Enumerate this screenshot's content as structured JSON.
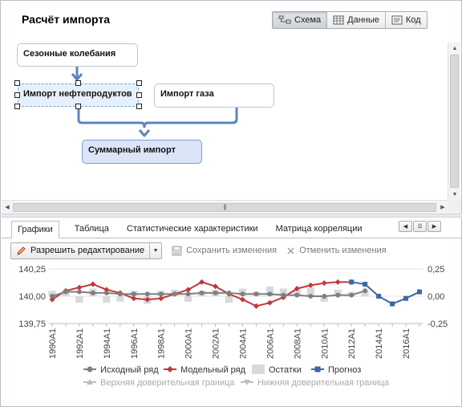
{
  "window": {
    "title": "Расчёт импорта"
  },
  "view_switch": {
    "buttons": [
      {
        "label": "Схема",
        "icon": "scheme-icon",
        "active": true
      },
      {
        "label": "Данные",
        "icon": "table-icon",
        "active": false
      },
      {
        "label": "Код",
        "icon": "code-icon",
        "active": false
      }
    ]
  },
  "diagram": {
    "nodes": {
      "seasonal": "Сезонные колебания",
      "oil_import": "Импорт нефтепродуктов",
      "gas_import": "Импорт газа",
      "total_import": "Суммарный импорт"
    },
    "edges": [
      {
        "from": "Сезонные колебания",
        "to": "Импорт нефтепродуктов"
      },
      {
        "from": "Импорт нефтепродуктов",
        "to": "Суммарный импорт"
      },
      {
        "from": "Импорт газа",
        "to": "Суммарный импорт"
      }
    ],
    "selected_node": "Импорт нефтепродуктов"
  },
  "tabs": {
    "items": [
      "Графики",
      "Таблица",
      "Статистические характеристики",
      "Матрица корреляции"
    ],
    "active": "Графики"
  },
  "toolbar": {
    "enable_edit": "Разрешить редактирование",
    "save": "Сохранить изменения",
    "cancel": "Отменить изменения"
  },
  "colors": {
    "original": "#7f7f7f",
    "model": "#c0393b",
    "residuals": "#d9d9d9",
    "forecast": "#3a68a8",
    "upper_band": "#bdbdbd",
    "lower_band": "#bdbdbd",
    "accent": "#5b85c0"
  },
  "chart_data": {
    "type": "line",
    "categories": [
      "1990A1",
      "1991A1",
      "1992A1",
      "1993A1",
      "1994A1",
      "1995A1",
      "1996A1",
      "1997A1",
      "1998A1",
      "1999A1",
      "2000A1",
      "2001A1",
      "2002A1",
      "2003A1",
      "2004A1",
      "2005A1",
      "2006A1",
      "2007A1",
      "2008A1",
      "2009A1",
      "2010A1",
      "2011A1",
      "2012A1",
      "2013A1",
      "2014A1",
      "2015A1",
      "2016A1",
      "2017A1"
    ],
    "tick_labels": [
      "1990A1",
      "1992A1",
      "1994A1",
      "1996A1",
      "1998A1",
      "2000A1",
      "2002A1",
      "2004A1",
      "2006A1",
      "2008A1",
      "2010A1",
      "2012A1",
      "2014A1",
      "2016A1"
    ],
    "y_left": {
      "ticks": [
        "139,75",
        "140,00",
        "140,25"
      ],
      "range": [
        139.75,
        140.25
      ]
    },
    "y_right": {
      "ticks": [
        "-0,25",
        "0,00",
        "0,25"
      ],
      "range": [
        -0.25,
        0.25
      ]
    },
    "series": [
      {
        "name": "Исходный ряд",
        "axis": "left",
        "style": "line-circle",
        "values": [
          140.0,
          140.04,
          140.04,
          140.03,
          140.03,
          140.02,
          140.02,
          140.02,
          140.02,
          140.02,
          140.02,
          140.03,
          140.03,
          140.03,
          140.02,
          140.02,
          140.02,
          140.01,
          140.01,
          140.0,
          140.0,
          140.01,
          140.01,
          140.05,
          null,
          null,
          null,
          null
        ]
      },
      {
        "name": "Модельный ряд",
        "axis": "left",
        "style": "line-diamond",
        "values": [
          139.97,
          140.05,
          140.08,
          140.11,
          140.06,
          140.03,
          139.98,
          139.97,
          139.98,
          140.02,
          140.06,
          140.13,
          140.09,
          140.02,
          139.97,
          139.91,
          139.94,
          139.99,
          140.07,
          140.1,
          140.12,
          140.13,
          140.13,
          null,
          null,
          null,
          null,
          null
        ]
      },
      {
        "name": "Остатки",
        "axis": "right",
        "style": "bar",
        "values": [
          0.05,
          0.05,
          -0.06,
          0.07,
          -0.06,
          -0.05,
          0.05,
          -0.07,
          0.05,
          0.06,
          -0.05,
          0.05,
          0.06,
          -0.06,
          0.07,
          0.04,
          0.09,
          0.07,
          0.06,
          0.08,
          -0.05,
          0.06,
          0.04,
          0.05,
          0,
          0,
          0,
          0
        ]
      },
      {
        "name": "Прогноз",
        "axis": "left",
        "style": "line-square",
        "values": [
          null,
          null,
          null,
          null,
          null,
          null,
          null,
          null,
          null,
          null,
          null,
          null,
          null,
          null,
          null,
          null,
          null,
          null,
          null,
          null,
          null,
          null,
          140.13,
          140.11,
          140.0,
          139.93,
          139.98,
          140.04
        ]
      },
      {
        "name": "Верхняя доверительная граница",
        "axis": "left",
        "style": "line-triangle-up",
        "values": []
      },
      {
        "name": "Нижняя доверительная граница",
        "axis": "left",
        "style": "line-triangle-down",
        "values": []
      }
    ],
    "legend": {
      "position": "bottom"
    },
    "grid": true
  }
}
